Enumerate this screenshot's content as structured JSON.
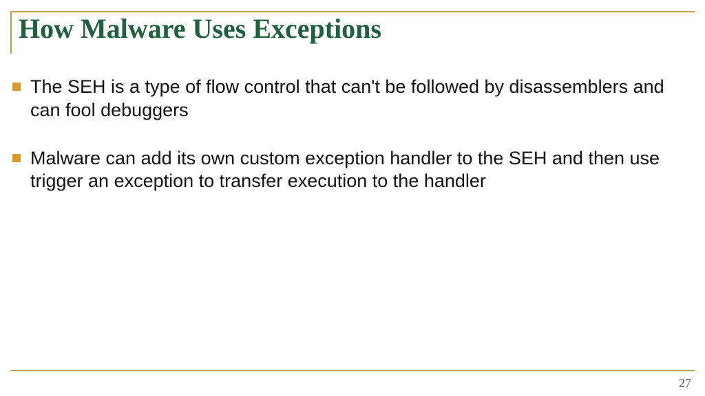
{
  "title": "How Malware Uses  Exceptions",
  "bullets": [
    "The SEH is a type of flow control that can't be followed by disassemblers and can fool debuggers",
    "Malware can add its own custom exception handler to the SEH and then use trigger an exception to transfer execution to the handler"
  ],
  "page_number": "27"
}
